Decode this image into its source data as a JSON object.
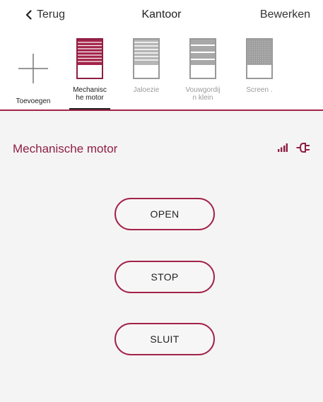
{
  "nav": {
    "back_label": "Terug",
    "title": "Kantoor",
    "edit_label": "Bewerken"
  },
  "devices": [
    {
      "label": "Toevoegen",
      "icon": "plus-icon",
      "active": false
    },
    {
      "label": "Mechanisc he motor",
      "icon": "roller-shutter-icon",
      "active": true
    },
    {
      "label": "Jaloezie",
      "icon": "venetian-blind-icon",
      "active": false
    },
    {
      "label": "Vouwgordij n  klein",
      "icon": "folding-curtain-icon",
      "active": false
    },
    {
      "label": "Screen .",
      "icon": "screen-shade-icon",
      "active": false
    }
  ],
  "panel": {
    "title": "Mechanische motor",
    "signal_icon": "signal-strength-icon",
    "power_icon": "plug-icon"
  },
  "controls": {
    "open_label": "OPEN",
    "stop_label": "STOP",
    "close_label": "SLUIT"
  },
  "colors": {
    "accent": "#a2234a",
    "title": "#8e1f44",
    "panel_bg": "#f5f4f4",
    "inactive_text": "#9a9a9a"
  }
}
